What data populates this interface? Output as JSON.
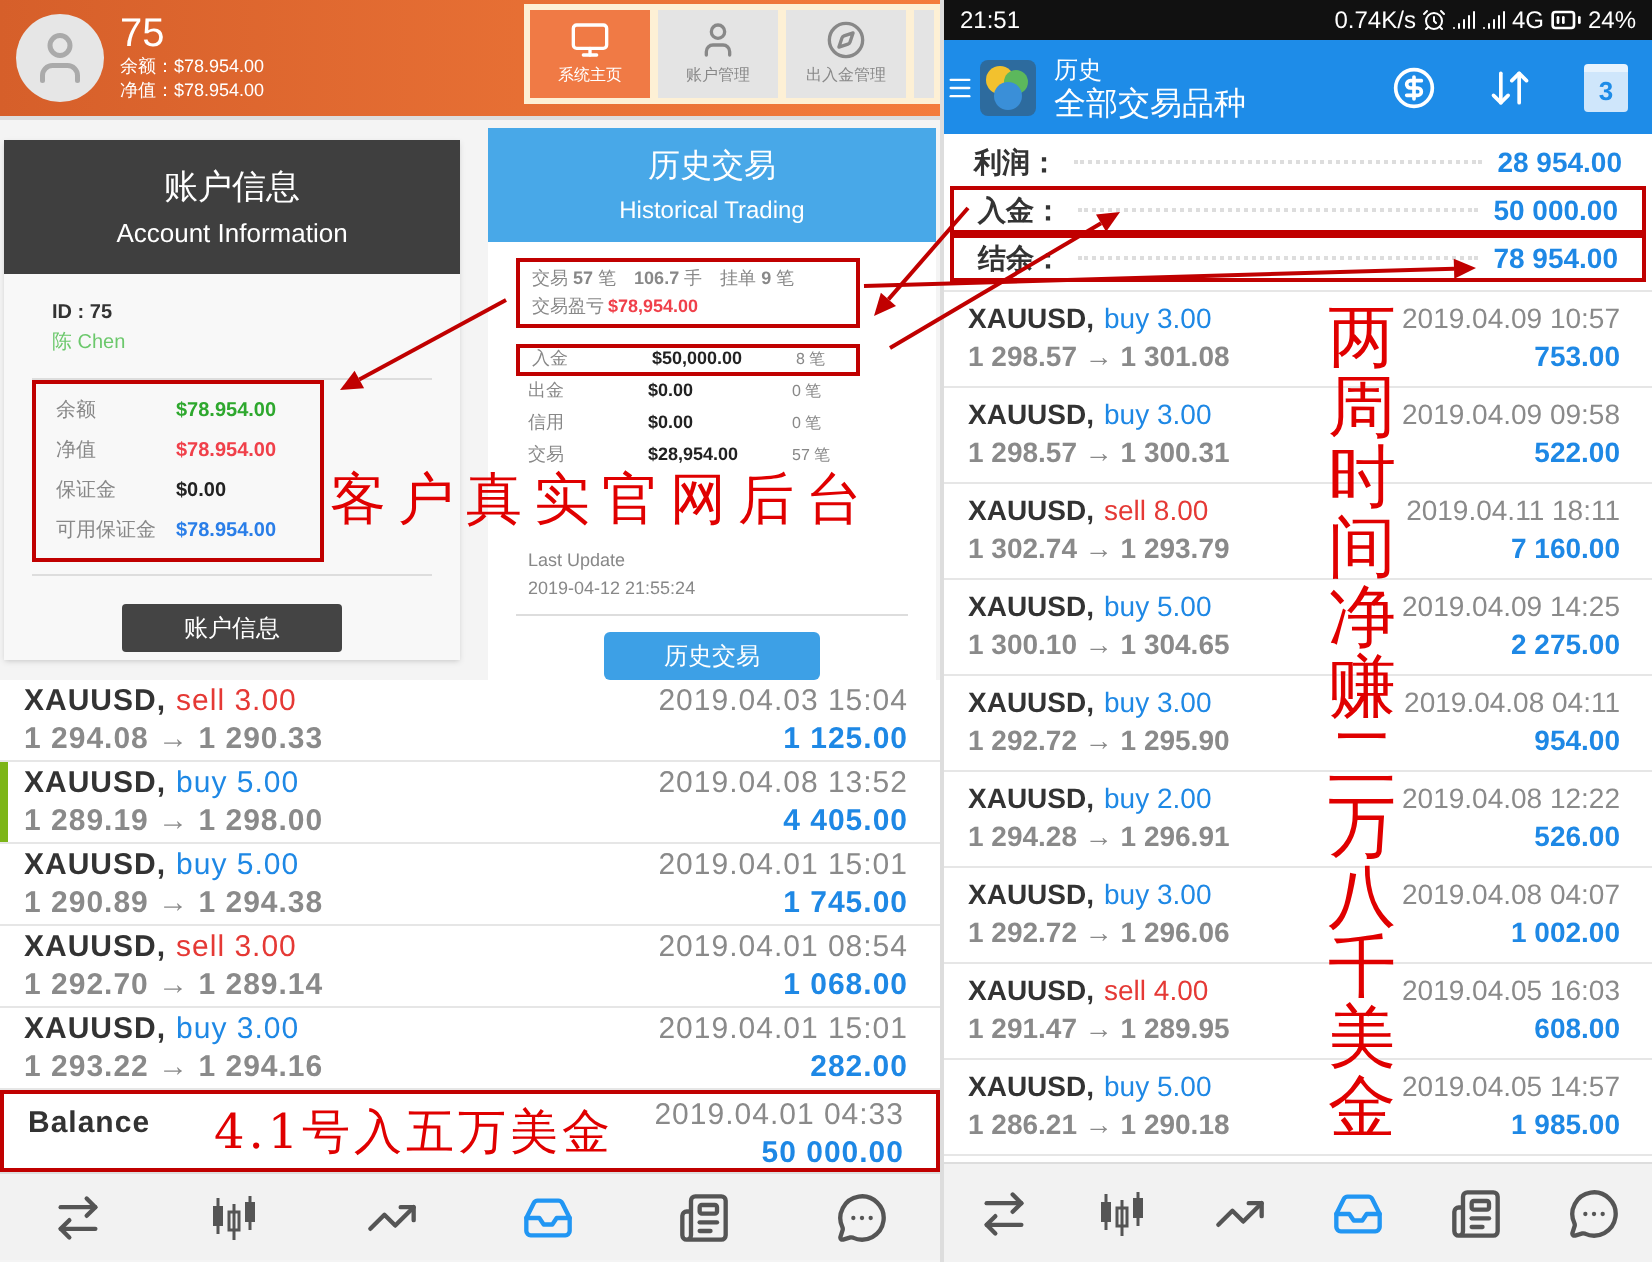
{
  "left_screen": {
    "header": {
      "account": "75",
      "balance_label": "余额：",
      "balance": "$78.954.00",
      "equity_label": "净值：",
      "equity": "$78.954.00",
      "nav_tabs": [
        {
          "label": "系统主页",
          "selected": true
        },
        {
          "label": "账户管理",
          "selected": false
        },
        {
          "label": "出入金管理",
          "selected": false
        }
      ]
    },
    "account_card": {
      "title": "账户信息",
      "subtitle": "Account Information",
      "id": "ID : 75",
      "name": "陈 Chen",
      "fields_highlighted": true,
      "fields": [
        {
          "label": "余额",
          "value": "$78.954.00",
          "color": "#2ea82e"
        },
        {
          "label": "净值",
          "value": "$78.954.00",
          "color": "#f0404a"
        },
        {
          "label": "保证金",
          "value": "$0.00",
          "color": "#222222"
        },
        {
          "label": "可用保证金",
          "value": "$78.954.00",
          "color": "#2a7ee8"
        }
      ],
      "button": "账户信息"
    },
    "history_card": {
      "title": "历史交易",
      "subtitle": "Historical Trading",
      "summary_highlighted": true,
      "stats": "交易 **57** 笔　**106.7** 手　挂单 **9** 笔",
      "pl_label": "交易盈亏",
      "pl_value": "$78,954.00",
      "rows": [
        {
          "label": "入金",
          "amount": "$50,000.00",
          "count": "8 笔",
          "highlighted": true
        },
        {
          "label": "出金",
          "amount": "$0.00",
          "count": "0 笔",
          "highlighted": false
        },
        {
          "label": "信用",
          "amount": "$0.00",
          "count": "0 笔",
          "highlighted": false
        },
        {
          "label": "交易",
          "amount": "$28,954.00",
          "count": "57 笔",
          "highlighted": false
        }
      ],
      "last_update_label": "Last Update",
      "last_update": "2019-04-12 21:55:24",
      "button": "历史交易"
    },
    "annotation": "客户真实官网后台",
    "trades": [
      {
        "kind": "trade",
        "symbol": "XAUUSD,",
        "color": "#e53935",
        "volume": "sell 3.00",
        "prices": "1 294.08 → 1 290.33",
        "time": "2019.04.03 15:04",
        "profit": "1 125.00",
        "selected": false,
        "highlighted": false
      },
      {
        "kind": "trade",
        "symbol": "XAUUSD,",
        "color": "#1e88e5",
        "volume": "buy 5.00",
        "prices": "1 289.19 → 1 298.00",
        "time": "2019.04.08 13:52",
        "profit": "4 405.00",
        "selected": true,
        "highlighted": false
      },
      {
        "kind": "trade",
        "symbol": "XAUUSD,",
        "color": "#1e88e5",
        "volume": "buy 5.00",
        "prices": "1 290.89 → 1 294.38",
        "time": "2019.04.01 15:01",
        "profit": "1 745.00",
        "selected": false,
        "highlighted": false
      },
      {
        "kind": "trade",
        "symbol": "XAUUSD,",
        "color": "#e53935",
        "volume": "sell 3.00",
        "prices": "1 292.70 → 1 289.14",
        "time": "2019.04.01 08:54",
        "profit": "1 068.00",
        "selected": false,
        "highlighted": false
      },
      {
        "kind": "trade",
        "symbol": "XAUUSD,",
        "color": "#1e88e5",
        "volume": "buy 3.00",
        "prices": "1 293.22 → 1 294.16",
        "time": "2019.04.01 15:01",
        "profit": "282.00",
        "selected": false,
        "highlighted": false
      },
      {
        "kind": "balance",
        "symbol": "Balance",
        "time": "2019.04.01 04:33",
        "profit": "50 000.00",
        "selected": false,
        "highlighted": true,
        "annotation": "4.1号入五万美金"
      }
    ],
    "bottom_nav": [
      {
        "selected": false
      },
      {
        "selected": false
      },
      {
        "selected": false
      },
      {
        "selected": true
      },
      {
        "selected": false
      },
      {
        "selected": false
      }
    ]
  },
  "right_screen": {
    "status_bar": {
      "time": "21:51",
      "speed": "0.74K/s",
      "network": "4G",
      "battery": "24%"
    },
    "app_bar": {
      "title": "历史",
      "subtitle": "全部交易品种",
      "calendar_day": "3"
    },
    "summary": [
      {
        "label": "利润：",
        "value": "28 954.00",
        "highlighted": false
      },
      {
        "label": "入金：",
        "value": "50 000.00",
        "highlighted": true
      },
      {
        "label": "结余：",
        "value": "78 954.00",
        "highlighted": true
      }
    ],
    "trades": [
      {
        "kind": "trade",
        "symbol": "XAUUSD,",
        "color": "#1e88e5",
        "volume": "buy 3.00",
        "prices": "1 298.57 → 1 301.08",
        "time": "2019.04.09 10:57",
        "profit": "753.00",
        "selected": false,
        "highlighted": false
      },
      {
        "kind": "trade",
        "symbol": "XAUUSD,",
        "color": "#1e88e5",
        "volume": "buy 3.00",
        "prices": "1 298.57 → 1 300.31",
        "time": "2019.04.09 09:58",
        "profit": "522.00",
        "selected": false,
        "highlighted": false
      },
      {
        "kind": "trade",
        "symbol": "XAUUSD,",
        "color": "#e53935",
        "volume": "sell 8.00",
        "prices": "1 302.74 → 1 293.79",
        "time": "2019.04.11 18:11",
        "profit": "7 160.00",
        "selected": false,
        "highlighted": false
      },
      {
        "kind": "trade",
        "symbol": "XAUUSD,",
        "color": "#1e88e5",
        "volume": "buy 5.00",
        "prices": "1 300.10 → 1 304.65",
        "time": "2019.04.09 14:25",
        "profit": "2 275.00",
        "selected": false,
        "highlighted": false
      },
      {
        "kind": "trade",
        "symbol": "XAUUSD,",
        "color": "#1e88e5",
        "volume": "buy 3.00",
        "prices": "1 292.72 → 1 295.90",
        "time": "2019.04.08 04:11",
        "profit": "954.00",
        "selected": false,
        "highlighted": false
      },
      {
        "kind": "trade",
        "symbol": "XAUUSD,",
        "color": "#1e88e5",
        "volume": "buy 2.00",
        "prices": "1 294.28 → 1 296.91",
        "time": "2019.04.08 12:22",
        "profit": "526.00",
        "selected": false,
        "highlighted": false
      },
      {
        "kind": "trade",
        "symbol": "XAUUSD,",
        "color": "#1e88e5",
        "volume": "buy 3.00",
        "prices": "1 292.72 → 1 296.06",
        "time": "2019.04.08 04:07",
        "profit": "1 002.00",
        "selected": false,
        "highlighted": false
      },
      {
        "kind": "trade",
        "symbol": "XAUUSD,",
        "color": "#e53935",
        "volume": "sell 4.00",
        "prices": "1 291.47 → 1 289.95",
        "time": "2019.04.05 16:03",
        "profit": "608.00",
        "selected": false,
        "highlighted": false
      },
      {
        "kind": "trade",
        "symbol": "XAUUSD,",
        "color": "#1e88e5",
        "volume": "buy 5.00",
        "prices": "1 286.21 → 1 290.18",
        "time": "2019.04.05 14:57",
        "profit": "1 985.00",
        "selected": false,
        "highlighted": false
      }
    ],
    "annotation": "两周时间净赚二万八千美金",
    "bottom_nav": [
      {
        "selected": false
      },
      {
        "selected": false
      },
      {
        "selected": false
      },
      {
        "selected": true
      },
      {
        "selected": false
      },
      {
        "selected": false
      }
    ]
  }
}
